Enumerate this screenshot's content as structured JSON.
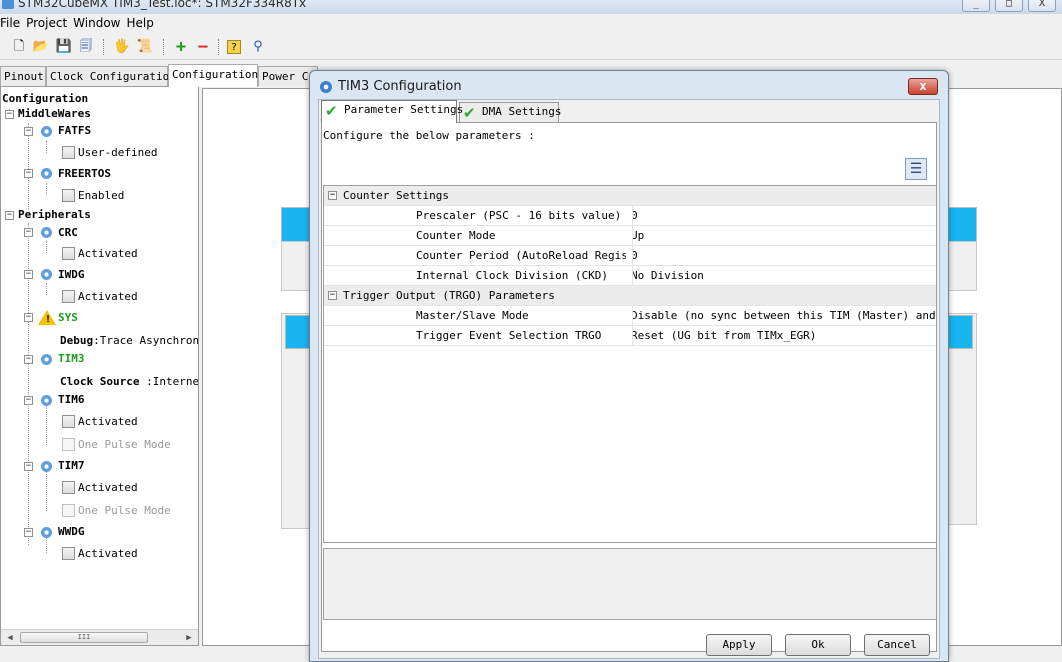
{
  "window": {
    "title": "STM32CubeMX TIM3_Test.ioc*: STM32F334R8Tx",
    "minimize": "_",
    "maximize": "□",
    "close": "X"
  },
  "menu": [
    "File",
    "Project",
    "Window",
    "Help"
  ],
  "toolbar": {
    "icons": [
      "new-file-icon",
      "open-folder-icon",
      "save-icon",
      "save-all-icon",
      "generate-report-icon",
      "generate-code-icon",
      "zoom-in-icon",
      "zoom-out-icon",
      "help-icon",
      "about-icon"
    ],
    "glyphs": [
      "🗋",
      "📂",
      "💾",
      "🗐",
      "🖐",
      "📜",
      "+",
      "−",
      "?",
      "⚲"
    ]
  },
  "tabs": [
    "Pinout",
    "Clock Configuration",
    "Configuration",
    "Power C"
  ],
  "tree": {
    "root": "Configuration",
    "middlewares": "MiddleWares",
    "fatfs": "FATFS",
    "fatfs_opt": "User-defined",
    "freertos": "FREERTOS",
    "freertos_opt": "Enabled",
    "peripherals": "Peripherals",
    "crc": "CRC",
    "crc_opt": "Activated",
    "iwdg": "IWDG",
    "iwdg_opt": "Activated",
    "sys": "SYS",
    "sys_debug_label": "Debug",
    "sys_debug_value": ":Trace Asynchrono",
    "tim3": "TIM3",
    "tim3_clock_label": "Clock Source",
    "tim3_clock_value": ":Interne",
    "tim6": "TIM6",
    "tim6_opt1": "Activated",
    "tim6_opt2": "One Pulse Mode",
    "tim7": "TIM7",
    "tim7_opt1": "Activated",
    "tim7_opt2": "One Pulse Mode",
    "wwdg": "WWDG",
    "wwdg_opt": "Activated",
    "scroll_thumb": "III"
  },
  "dialog": {
    "title": "TIM3 Configuration",
    "close": "x",
    "tabs": [
      "Parameter Settings",
      "DMA Settings"
    ],
    "description": "Configure the below parameters :",
    "groups": [
      {
        "name": "Counter Settings",
        "params": [
          {
            "name": "Prescaler (PSC - 16 bits value)",
            "value": "0"
          },
          {
            "name": "Counter Mode",
            "value": "Up"
          },
          {
            "name": "Counter Period (AutoReload Regis...",
            "value": "0"
          },
          {
            "name": "Internal Clock Division (CKD)",
            "value": "No Division"
          }
        ]
      },
      {
        "name": "Trigger Output (TRGO) Parameters",
        "params": [
          {
            "name": "Master/Slave Mode",
            "value": "Disable (no sync between this TIM (Master) and ..."
          },
          {
            "name": "Trigger Event Selection TRGO",
            "value": "Reset (UG bit from TIMx_EGR)"
          }
        ]
      }
    ],
    "buttons": {
      "apply": "Apply",
      "ok": "Ok",
      "cancel": "Cancel"
    }
  },
  "colors": {
    "accent_blue": "#18b5f1",
    "active_green": "#1c9e1c",
    "warning_yellow": "#f2c200"
  }
}
